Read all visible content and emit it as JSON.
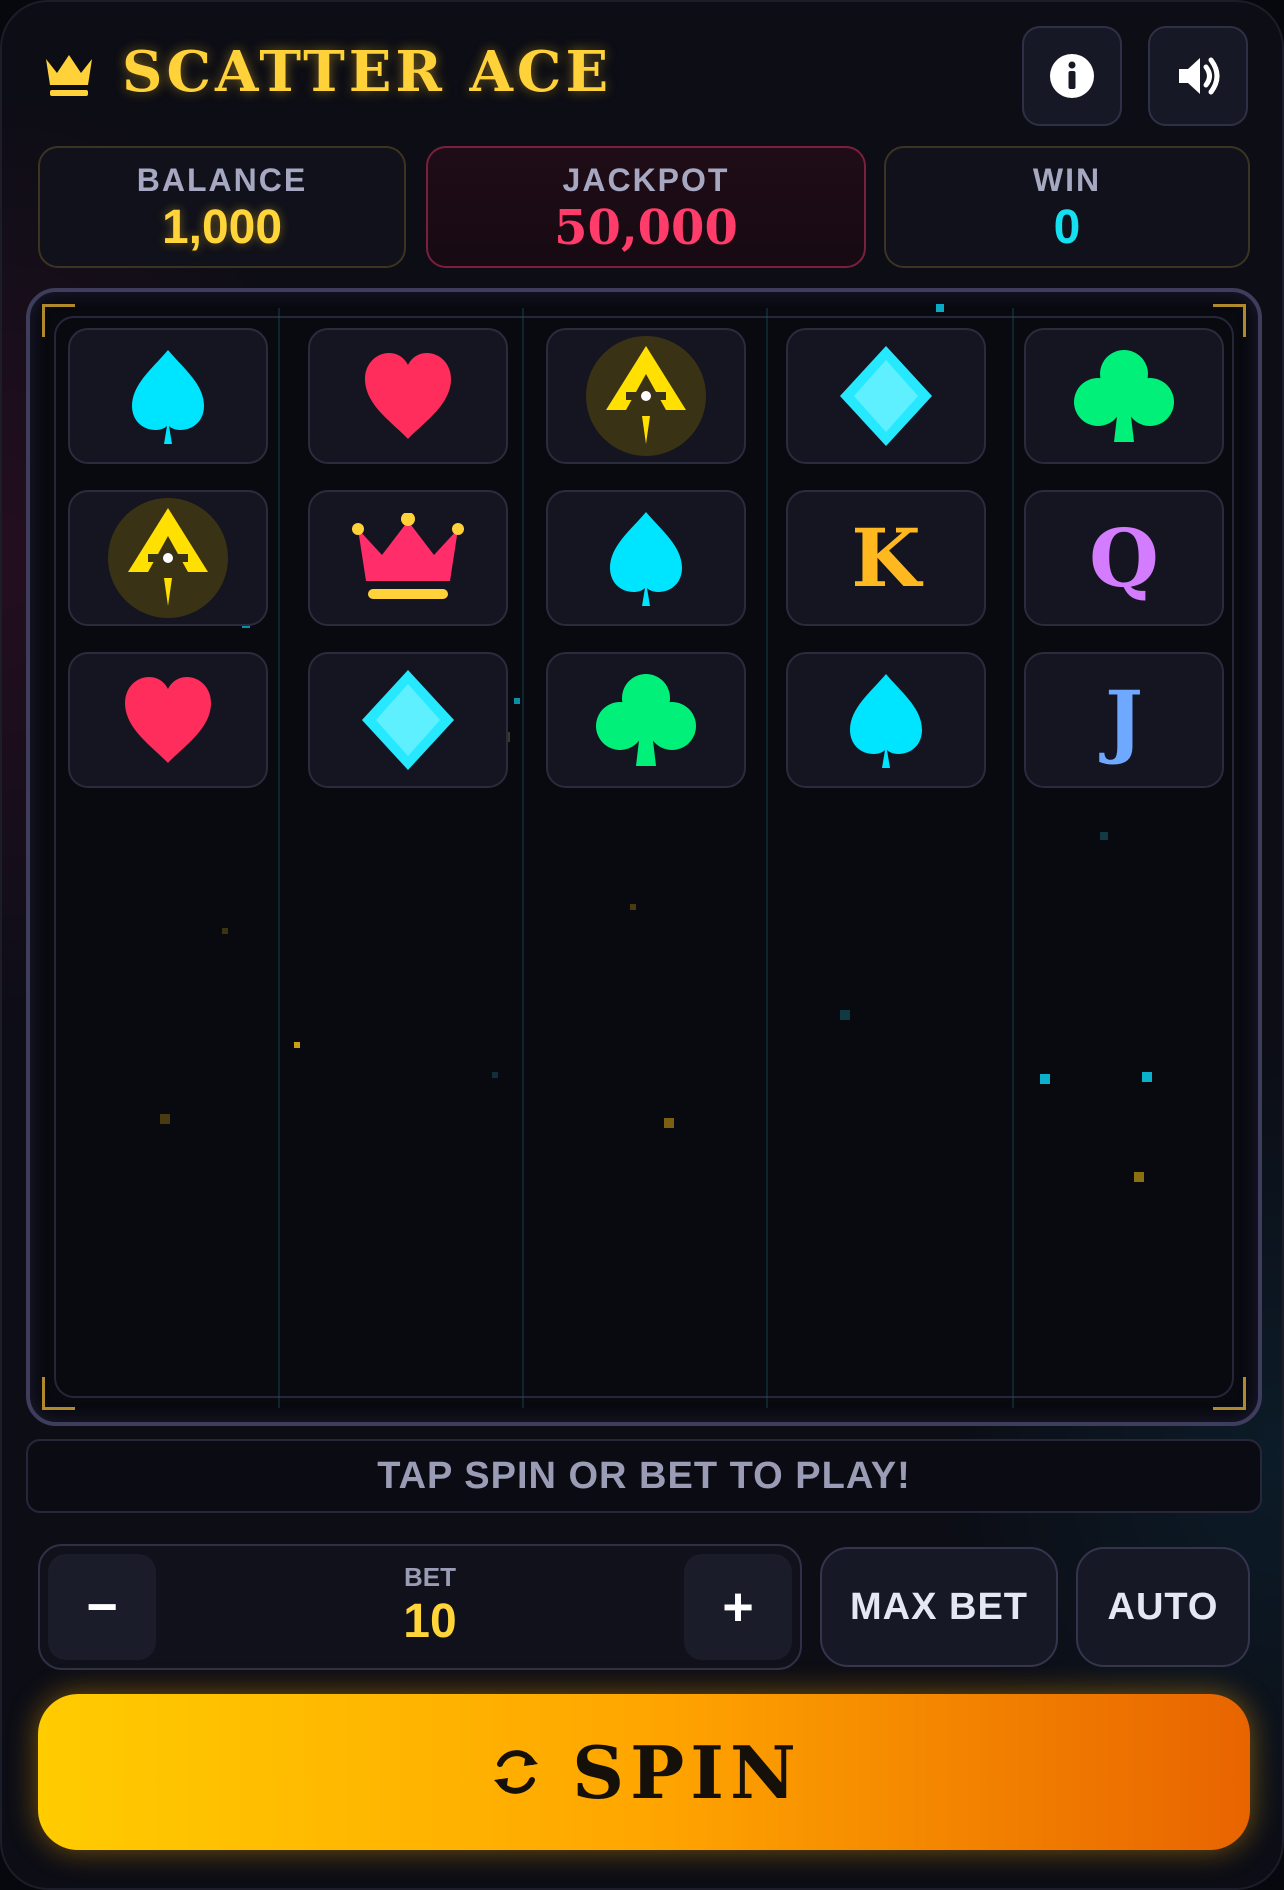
{
  "header": {
    "title": "SCATTER ACE",
    "icons": {
      "logo": "crown-icon",
      "info": "info-icon",
      "sound": "speaker-icon"
    }
  },
  "stats": {
    "balance": {
      "label": "BALANCE",
      "value": "1,000"
    },
    "jackpot": {
      "label": "JACKPOT",
      "value": "50,000"
    },
    "win": {
      "label": "WIN",
      "value": "0"
    }
  },
  "reels": {
    "rows": [
      [
        "spade",
        "heart",
        "ace-scatter",
        "diamond",
        "club"
      ],
      [
        "ace-scatter",
        "crown",
        "spade",
        "K",
        "Q"
      ],
      [
        "heart",
        "diamond",
        "club",
        "spade",
        "J"
      ]
    ],
    "letters": {
      "K": "K",
      "Q": "Q",
      "J": "J"
    }
  },
  "status": {
    "message": "TAP SPIN OR BET TO PLAY!"
  },
  "bet": {
    "label": "BET",
    "value": "10",
    "minus_label": "−",
    "plus_label": "+"
  },
  "buttons": {
    "max_bet": "MAX BET",
    "auto": "AUTO",
    "spin": "SPIN"
  },
  "colors": {
    "gold": "#ffd23a",
    "jackpot": "#ff3c6a",
    "win": "#14e0f0",
    "spade": "#00e5ff",
    "heart": "#ff2d5c",
    "diamond": "#26e8ff",
    "club": "#00f07a",
    "crown_symbol": "#ff2d6a",
    "king": "#ffb820",
    "queen": "#d47cff",
    "jack": "#6fa8ff"
  }
}
